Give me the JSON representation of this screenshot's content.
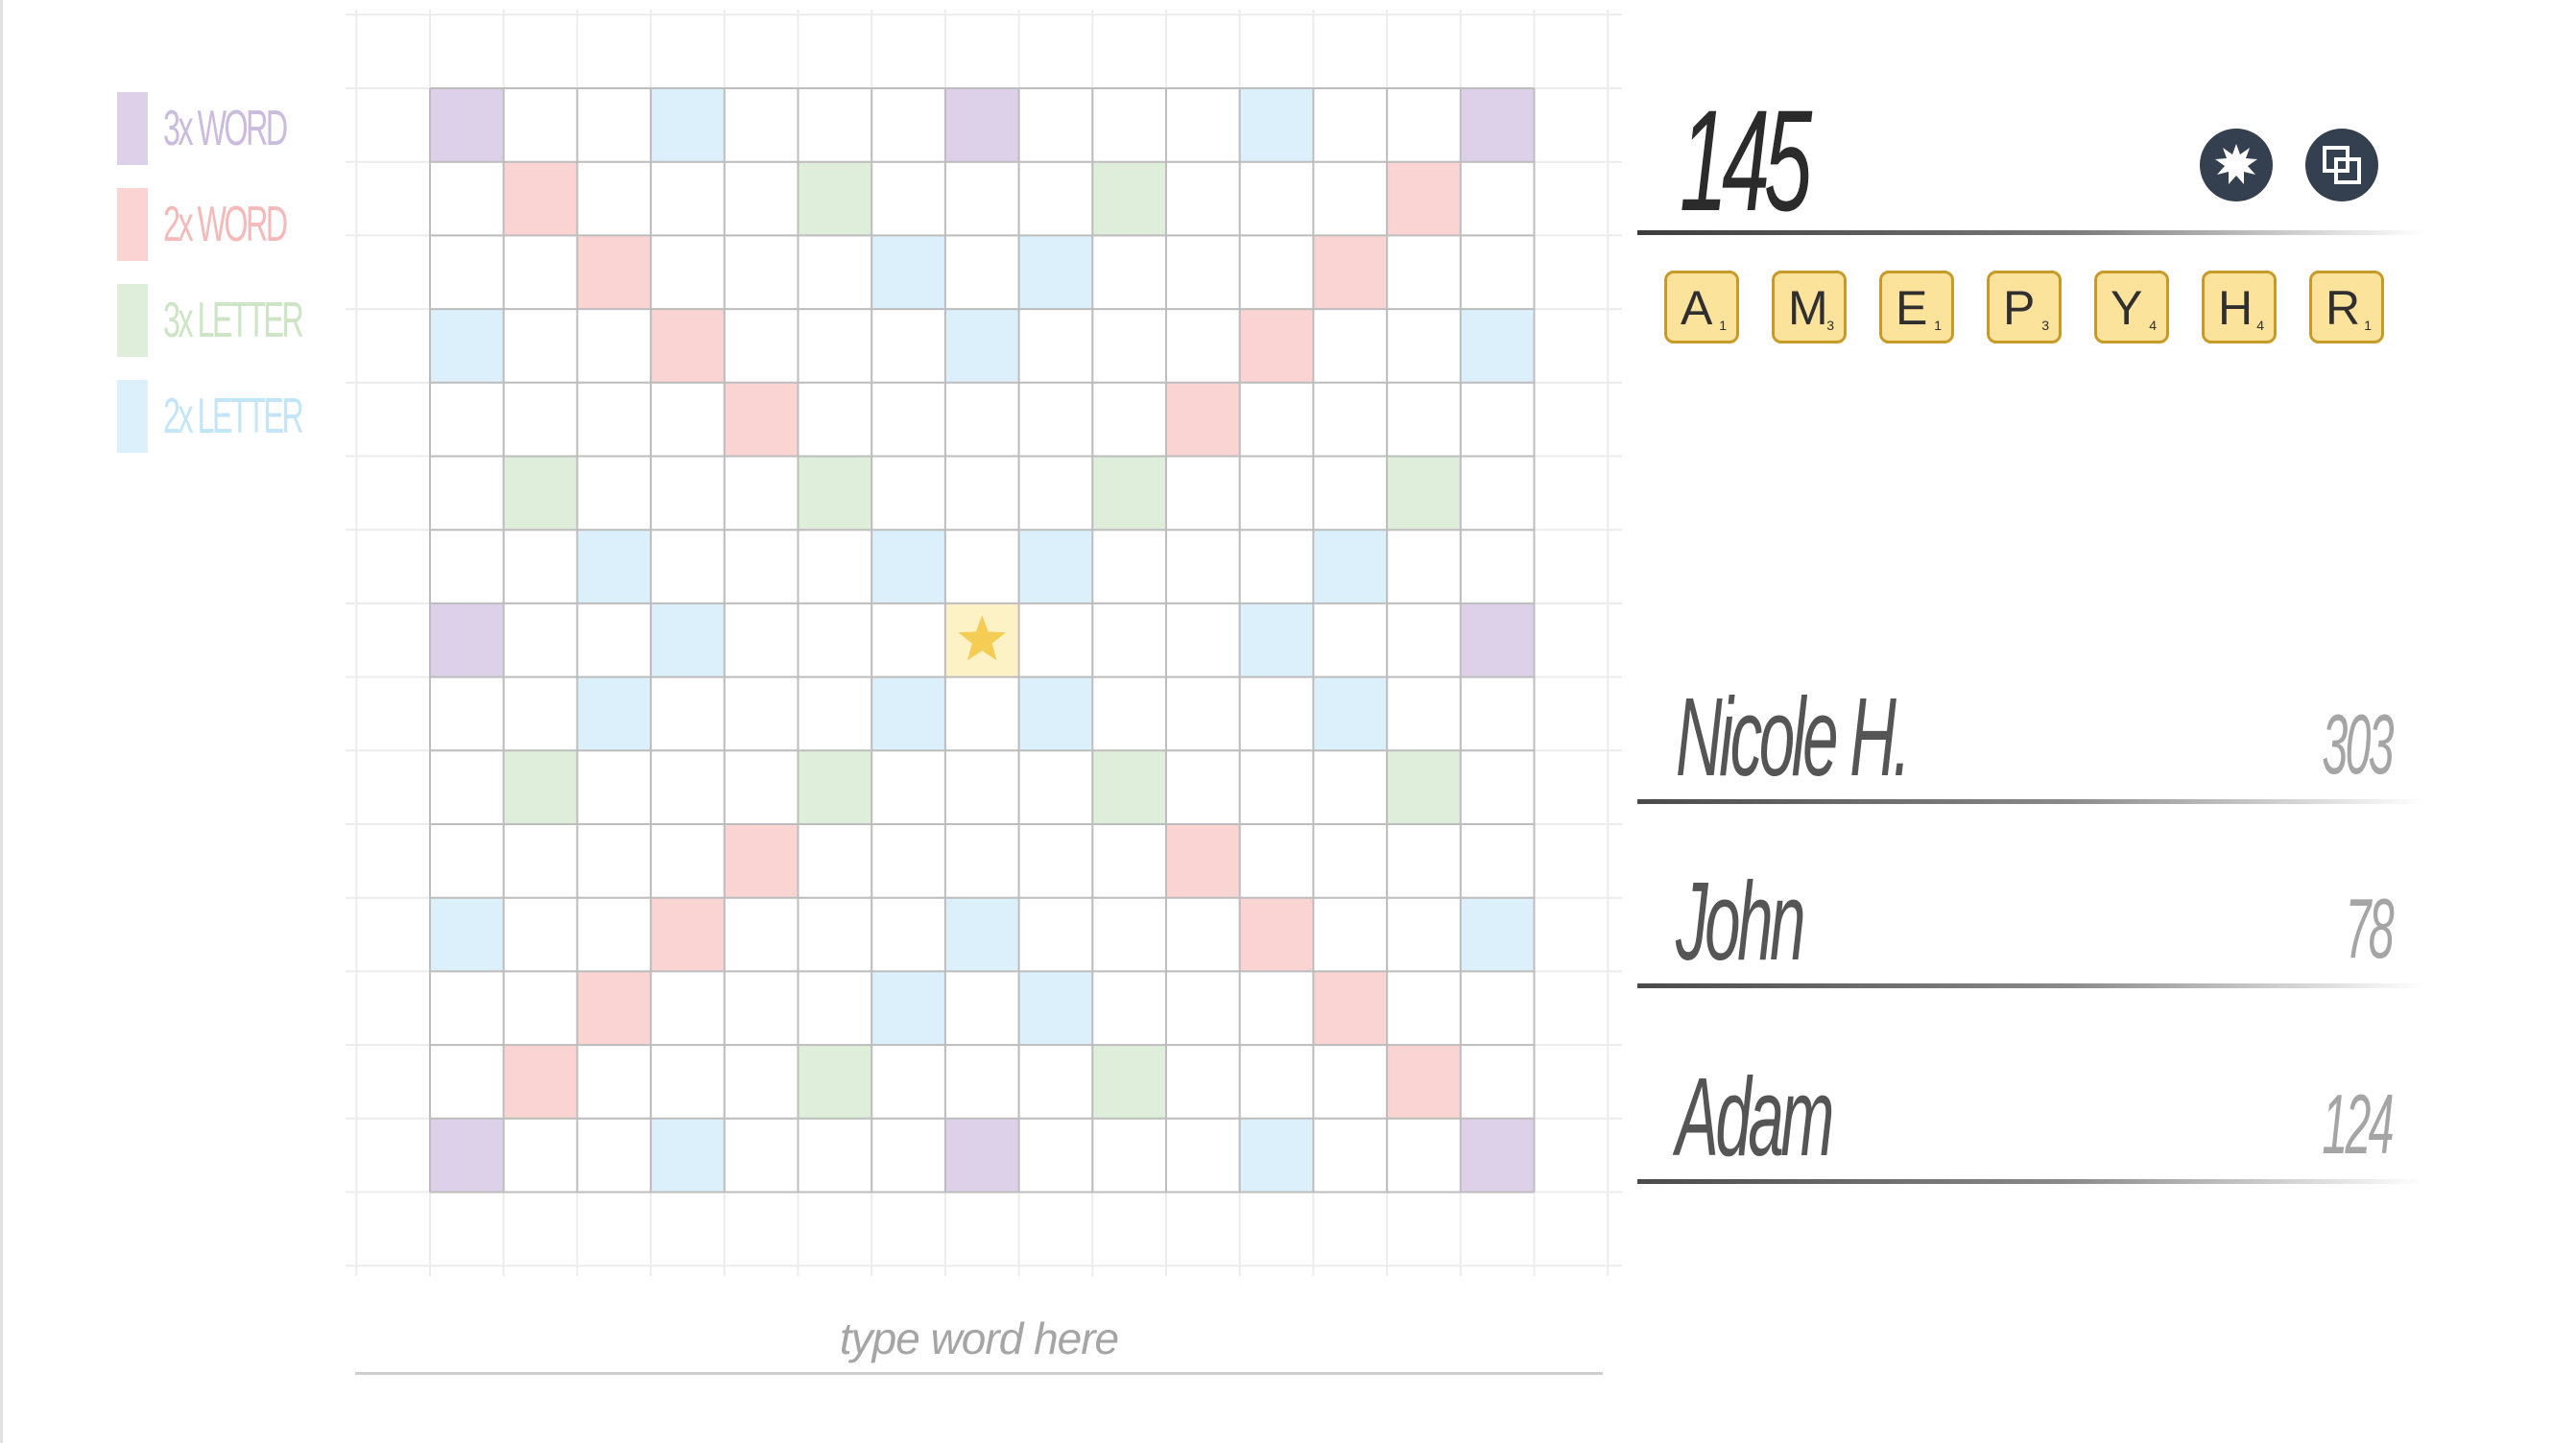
{
  "legend": [
    {
      "label": "3x WORD",
      "color": "#dcd1e8",
      "text_color": "#cbbcdf"
    },
    {
      "label": "2x WORD",
      "color": "#fad3d3",
      "text_color": "#f5b9b9"
    },
    {
      "label": "3x LETTER",
      "color": "#dfeeda",
      "text_color": "#cde4c5"
    },
    {
      "label": "2x LETTER",
      "color": "#dbf0fa",
      "text_color": "#c2e6f7"
    }
  ],
  "board": {
    "size": 15,
    "center_icon": "star-icon",
    "colors": {
      "TW": "#dcd1e8",
      "DW": "#fad3d3",
      "TL": "#dfeeda",
      "DL": "#dbf0fa",
      "star_bg": "#fdf1c6",
      "star": "#f5cd55"
    }
  },
  "word_input": {
    "placeholder": "type word here"
  },
  "current_score": "145",
  "actions": [
    {
      "icon": "burst-icon"
    },
    {
      "icon": "swap-icon"
    }
  ],
  "rack": [
    {
      "letter": "A",
      "points": "1"
    },
    {
      "letter": "M",
      "points": "3"
    },
    {
      "letter": "E",
      "points": "1"
    },
    {
      "letter": "P",
      "points": "3"
    },
    {
      "letter": "Y",
      "points": "4"
    },
    {
      "letter": "H",
      "points": "4"
    },
    {
      "letter": "R",
      "points": "1"
    }
  ],
  "players": [
    {
      "name": "Nicole H.",
      "score": "303"
    },
    {
      "name": "John",
      "score": "78"
    },
    {
      "name": "Adam",
      "score": "124"
    }
  ]
}
